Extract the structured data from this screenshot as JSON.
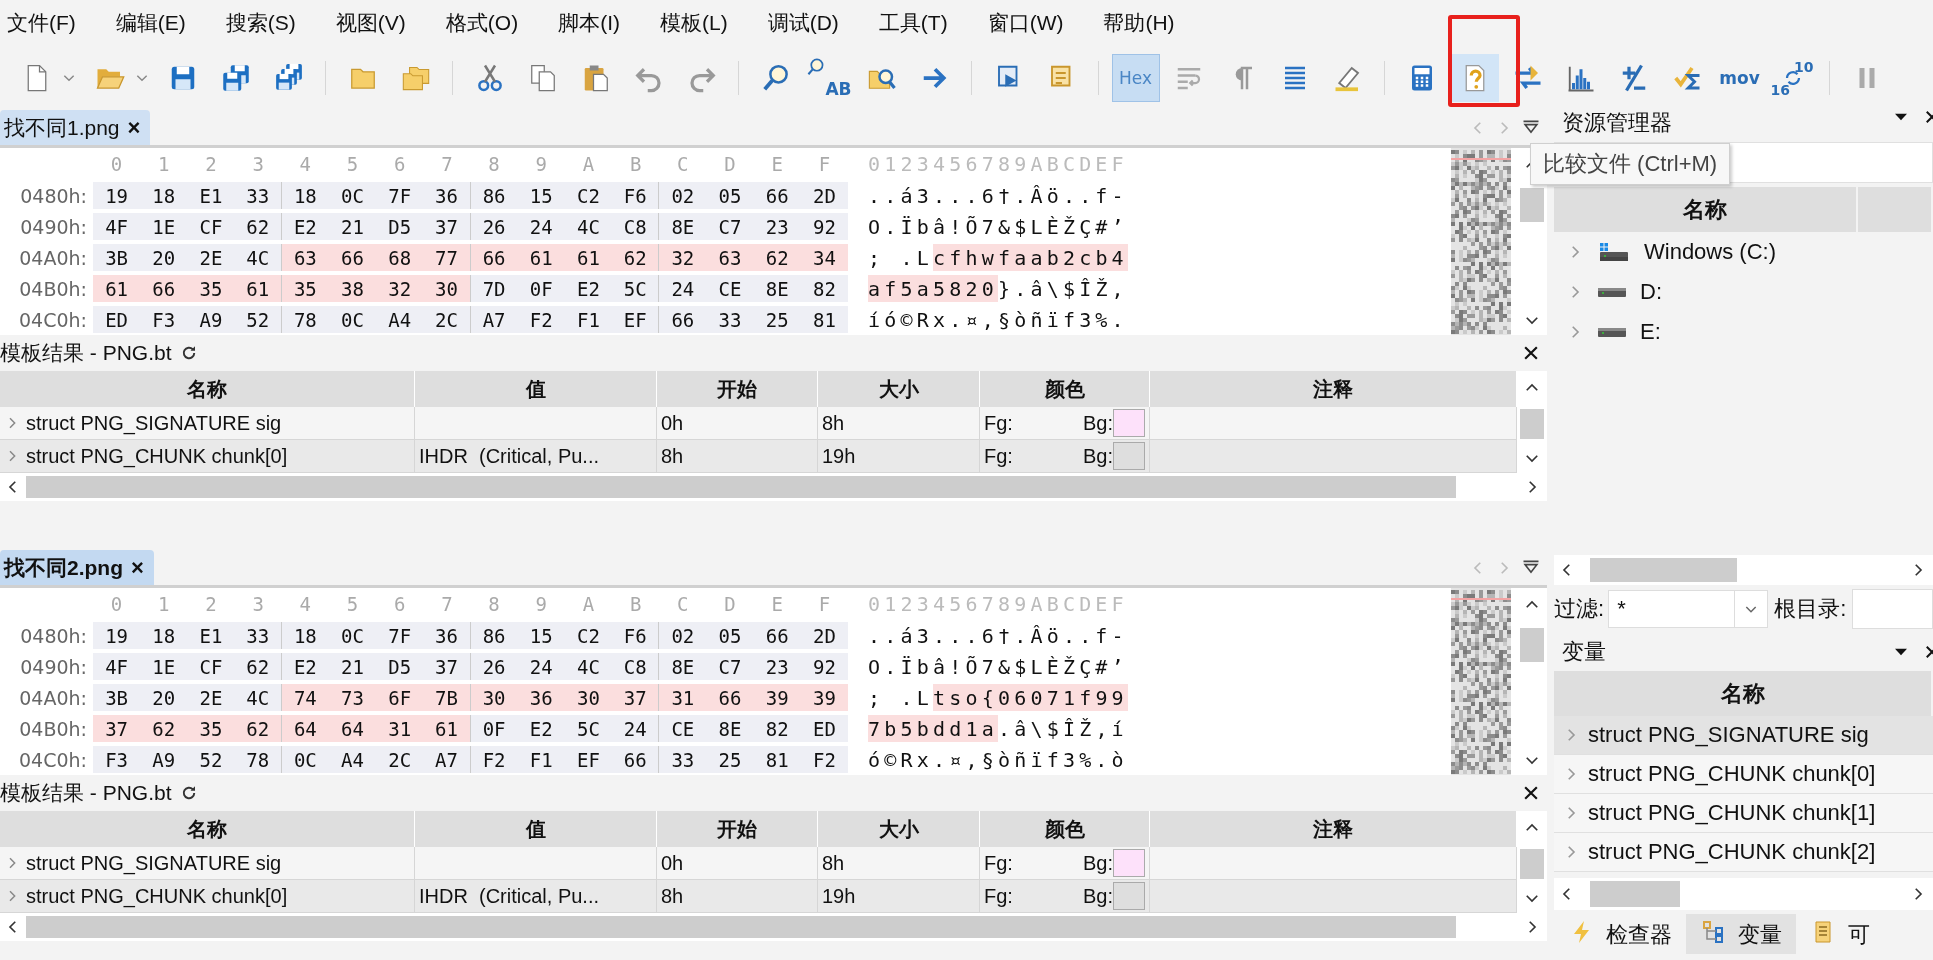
{
  "menu": [
    "文件(F)",
    "编辑(E)",
    "搜索(S)",
    "视图(V)",
    "格式(O)",
    "脚本(I)",
    "模板(L)",
    "调试(D)",
    "工具(T)",
    "窗口(W)",
    "帮助(H)"
  ],
  "toolbar": [
    {
      "kind": "icon"
    },
    {
      "kind": "dropdown"
    },
    {
      "kind": "icon"
    },
    {
      "kind": "dropdown"
    },
    {
      "kind": "icon"
    },
    {
      "kind": "icon"
    },
    {
      "kind": "icon"
    },
    {
      "kind": "separator"
    },
    {
      "kind": "icon"
    },
    {
      "kind": "icon"
    },
    {
      "kind": "separator"
    },
    {
      "kind": "icon"
    },
    {
      "kind": "icon"
    },
    {
      "kind": "icon"
    },
    {
      "kind": "icon"
    },
    {
      "kind": "icon"
    },
    {
      "kind": "separator"
    },
    {
      "kind": "icon"
    },
    {
      "kind": "icon",
      "label": "AB"
    },
    {
      "kind": "icon"
    },
    {
      "kind": "icon"
    },
    {
      "kind": "separator"
    },
    {
      "kind": "icon"
    },
    {
      "kind": "icon"
    },
    {
      "kind": "separator"
    },
    {
      "kind": "toggle",
      "label": "Hex",
      "on": true
    },
    {
      "kind": "icon"
    },
    {
      "kind": "icon"
    },
    {
      "kind": "icon"
    },
    {
      "kind": "icon"
    },
    {
      "kind": "separator"
    },
    {
      "kind": "icon"
    },
    {
      "kind": "icon",
      "hovered": true,
      "annotated": true
    },
    {
      "kind": "icon"
    },
    {
      "kind": "icon"
    },
    {
      "kind": "icon"
    },
    {
      "kind": "icon"
    },
    {
      "kind": "text",
      "label": "mov"
    },
    {
      "kind": "convert",
      "labels": [
        "10",
        "16"
      ]
    },
    {
      "kind": "separator"
    },
    {
      "kind": "icon"
    }
  ],
  "tooltip": {
    "text": "比较文件 (Ctrl+M)"
  },
  "files": [
    {
      "tab": {
        "label": "找不同1.png",
        "close": "×",
        "selected": false
      },
      "hex": {
        "columns": [
          "0",
          "1",
          "2",
          "3",
          "4",
          "5",
          "6",
          "7",
          "8",
          "9",
          "A",
          "B",
          "C",
          "D",
          "E",
          "F"
        ],
        "ascii_header": "0123456789ABCDEF",
        "rows": [
          {
            "address": "0480h:",
            "bytes": [
              {
                "text": "19",
                "diff": false
              },
              {
                "text": "18",
                "diff": false
              },
              {
                "text": "E1",
                "diff": false
              },
              {
                "text": "33",
                "diff": false
              },
              {
                "text": "18",
                "diff": false
              },
              {
                "text": "0C",
                "diff": false
              },
              {
                "text": "7F",
                "diff": false
              },
              {
                "text": "36",
                "diff": false
              },
              {
                "text": "86",
                "diff": false
              },
              {
                "text": "15",
                "diff": false
              },
              {
                "text": "C2",
                "diff": false
              },
              {
                "text": "F6",
                "diff": false
              },
              {
                "text": "02",
                "diff": false
              },
              {
                "text": "05",
                "diff": false
              },
              {
                "text": "66",
                "diff": false
              },
              {
                "text": "2D",
                "diff": false
              }
            ],
            "ascii": [
              {
                "text": "..á3...6†.Âö..f-",
                "diff": false
              }
            ]
          },
          {
            "address": "0490h:",
            "bytes": [
              {
                "text": "4F",
                "diff": false
              },
              {
                "text": "1E",
                "diff": false
              },
              {
                "text": "CF",
                "diff": false
              },
              {
                "text": "62",
                "diff": false
              },
              {
                "text": "E2",
                "diff": false
              },
              {
                "text": "21",
                "diff": false
              },
              {
                "text": "D5",
                "diff": false
              },
              {
                "text": "37",
                "diff": false
              },
              {
                "text": "26",
                "diff": false
              },
              {
                "text": "24",
                "diff": false
              },
              {
                "text": "4C",
                "diff": false
              },
              {
                "text": "C8",
                "diff": false
              },
              {
                "text": "8E",
                "diff": false
              },
              {
                "text": "C7",
                "diff": false
              },
              {
                "text": "23",
                "diff": false
              },
              {
                "text": "92",
                "diff": false
              }
            ],
            "ascii": [
              {
                "text": "O.Ïbâ!Õ7&$LÈŽÇ#’",
                "diff": false
              }
            ]
          },
          {
            "address": "04A0h:",
            "bytes": [
              {
                "text": "3B",
                "diff": false
              },
              {
                "text": "20",
                "diff": false
              },
              {
                "text": "2E",
                "diff": false
              },
              {
                "text": "4C",
                "diff": false
              },
              {
                "text": "63",
                "diff": true
              },
              {
                "text": "66",
                "diff": true
              },
              {
                "text": "68",
                "diff": true
              },
              {
                "text": "77",
                "diff": true
              },
              {
                "text": "66",
                "diff": true
              },
              {
                "text": "61",
                "diff": true
              },
              {
                "text": "61",
                "diff": true
              },
              {
                "text": "62",
                "diff": true
              },
              {
                "text": "32",
                "diff": true
              },
              {
                "text": "63",
                "diff": true
              },
              {
                "text": "62",
                "diff": true
              },
              {
                "text": "34",
                "diff": true
              }
            ],
            "ascii": [
              {
                "text": "; .L",
                "diff": false
              },
              {
                "text": "cfhwfaab2cb4",
                "diff": true
              }
            ]
          },
          {
            "address": "04B0h:",
            "bytes": [
              {
                "text": "61",
                "diff": true
              },
              {
                "text": "66",
                "diff": true
              },
              {
                "text": "35",
                "diff": true
              },
              {
                "text": "61",
                "diff": true
              },
              {
                "text": "35",
                "diff": true
              },
              {
                "text": "38",
                "diff": true
              },
              {
                "text": "32",
                "diff": true
              },
              {
                "text": "30",
                "diff": true
              },
              {
                "text": "7D",
                "diff": false
              },
              {
                "text": "0F",
                "diff": false
              },
              {
                "text": "E2",
                "diff": false
              },
              {
                "text": "5C",
                "diff": false
              },
              {
                "text": "24",
                "diff": false
              },
              {
                "text": "CE",
                "diff": false
              },
              {
                "text": "8E",
                "diff": false
              },
              {
                "text": "82",
                "diff": false
              }
            ],
            "ascii": [
              {
                "text": "af5a5820",
                "diff": true
              },
              {
                "text": "}.â\\$ÎŽ,",
                "diff": false
              }
            ]
          },
          {
            "address": "04C0h:",
            "bytes": [
              {
                "text": "ED",
                "diff": false
              },
              {
                "text": "F3",
                "diff": false
              },
              {
                "text": "A9",
                "diff": false
              },
              {
                "text": "52",
                "diff": false
              },
              {
                "text": "78",
                "diff": false
              },
              {
                "text": "0C",
                "diff": false
              },
              {
                "text": "A4",
                "diff": false
              },
              {
                "text": "2C",
                "diff": false
              },
              {
                "text": "A7",
                "diff": false
              },
              {
                "text": "F2",
                "diff": false
              },
              {
                "text": "F1",
                "diff": false
              },
              {
                "text": "EF",
                "diff": false
              },
              {
                "text": "66",
                "diff": false
              },
              {
                "text": "33",
                "diff": false
              },
              {
                "text": "25",
                "diff": false
              },
              {
                "text": "81",
                "diff": false
              }
            ],
            "ascii": [
              {
                "text": "íó©Rx.¤,§òñïf3%.",
                "diff": false
              }
            ]
          }
        ]
      },
      "template": {
        "title": "模板结果 - PNG.bt",
        "columns": [
          "名称",
          "值",
          "开始",
          "大小",
          "颜色",
          "注释"
        ],
        "rows": [
          {
            "name": "struct PNG_SIGNATURE sig",
            "start": "0h",
            "size": "8h",
            "fg": "Fg:",
            "bg": "Bg:",
            "color": "#fde1fa"
          },
          {
            "name": "struct PNG_CHUNK chunk[0]",
            "value": "IHDR  (Critical, Pu...",
            "start": "8h",
            "size": "19h",
            "fg": "Fg:",
            "bg": "Bg:",
            "color": "#dedede"
          }
        ]
      }
    },
    {
      "tab": {
        "label": "找不同2.png",
        "close": "×",
        "selected": true
      },
      "hex": {
        "columns": [
          "0",
          "1",
          "2",
          "3",
          "4",
          "5",
          "6",
          "7",
          "8",
          "9",
          "A",
          "B",
          "C",
          "D",
          "E",
          "F"
        ],
        "ascii_header": "0123456789ABCDEF",
        "rows": [
          {
            "address": "0480h:",
            "bytes": [
              {
                "text": "19",
                "diff": false
              },
              {
                "text": "18",
                "diff": false
              },
              {
                "text": "E1",
                "diff": false
              },
              {
                "text": "33",
                "diff": false
              },
              {
                "text": "18",
                "diff": false
              },
              {
                "text": "0C",
                "diff": false
              },
              {
                "text": "7F",
                "diff": false
              },
              {
                "text": "36",
                "diff": false
              },
              {
                "text": "86",
                "diff": false
              },
              {
                "text": "15",
                "diff": false
              },
              {
                "text": "C2",
                "diff": false
              },
              {
                "text": "F6",
                "diff": false
              },
              {
                "text": "02",
                "diff": false
              },
              {
                "text": "05",
                "diff": false
              },
              {
                "text": "66",
                "diff": false
              },
              {
                "text": "2D",
                "diff": false
              }
            ],
            "ascii": [
              {
                "text": "..á3...6†.Âö..f-",
                "diff": false
              }
            ]
          },
          {
            "address": "0490h:",
            "bytes": [
              {
                "text": "4F",
                "diff": false
              },
              {
                "text": "1E",
                "diff": false
              },
              {
                "text": "CF",
                "diff": false
              },
              {
                "text": "62",
                "diff": false
              },
              {
                "text": "E2",
                "diff": false
              },
              {
                "text": "21",
                "diff": false
              },
              {
                "text": "D5",
                "diff": false
              },
              {
                "text": "37",
                "diff": false
              },
              {
                "text": "26",
                "diff": false
              },
              {
                "text": "24",
                "diff": false
              },
              {
                "text": "4C",
                "diff": false
              },
              {
                "text": "C8",
                "diff": false
              },
              {
                "text": "8E",
                "diff": false
              },
              {
                "text": "C7",
                "diff": false
              },
              {
                "text": "23",
                "diff": false
              },
              {
                "text": "92",
                "diff": false
              }
            ],
            "ascii": [
              {
                "text": "O.Ïbâ!Õ7&$LÈŽÇ#’",
                "diff": false
              }
            ]
          },
          {
            "address": "04A0h:",
            "bytes": [
              {
                "text": "3B",
                "diff": false
              },
              {
                "text": "20",
                "diff": false
              },
              {
                "text": "2E",
                "diff": false
              },
              {
                "text": "4C",
                "diff": false
              },
              {
                "text": "74",
                "diff": true
              },
              {
                "text": "73",
                "diff": true
              },
              {
                "text": "6F",
                "diff": true
              },
              {
                "text": "7B",
                "diff": true
              },
              {
                "text": "30",
                "diff": true
              },
              {
                "text": "36",
                "diff": true
              },
              {
                "text": "30",
                "diff": true
              },
              {
                "text": "37",
                "diff": true
              },
              {
                "text": "31",
                "diff": true
              },
              {
                "text": "66",
                "diff": true
              },
              {
                "text": "39",
                "diff": true
              },
              {
                "text": "39",
                "diff": true
              }
            ],
            "ascii": [
              {
                "text": "; .L",
                "diff": false
              },
              {
                "text": "tso{06071f99",
                "diff": true
              }
            ]
          },
          {
            "address": "04B0h:",
            "bytes": [
              {
                "text": "37",
                "diff": true
              },
              {
                "text": "62",
                "diff": true
              },
              {
                "text": "35",
                "diff": true
              },
              {
                "text": "62",
                "diff": true
              },
              {
                "text": "64",
                "diff": true
              },
              {
                "text": "64",
                "diff": true
              },
              {
                "text": "31",
                "diff": true
              },
              {
                "text": "61",
                "diff": true
              },
              {
                "text": "0F",
                "diff": false
              },
              {
                "text": "E2",
                "diff": false
              },
              {
                "text": "5C",
                "diff": false
              },
              {
                "text": "24",
                "diff": false
              },
              {
                "text": "CE",
                "diff": false
              },
              {
                "text": "8E",
                "diff": false
              },
              {
                "text": "82",
                "diff": false
              },
              {
                "text": "ED",
                "diff": false
              }
            ],
            "ascii": [
              {
                "text": "7b5bdd1a",
                "diff": true
              },
              {
                "text": ".â\\$ÎŽ,í",
                "diff": false
              }
            ]
          },
          {
            "address": "04C0h:",
            "bytes": [
              {
                "text": "F3",
                "diff": false
              },
              {
                "text": "A9",
                "diff": false
              },
              {
                "text": "52",
                "diff": false
              },
              {
                "text": "78",
                "diff": false
              },
              {
                "text": "0C",
                "diff": false
              },
              {
                "text": "A4",
                "diff": false
              },
              {
                "text": "2C",
                "diff": false
              },
              {
                "text": "A7",
                "diff": false
              },
              {
                "text": "F2",
                "diff": false
              },
              {
                "text": "F1",
                "diff": false
              },
              {
                "text": "EF",
                "diff": false
              },
              {
                "text": "66",
                "diff": false
              },
              {
                "text": "33",
                "diff": false
              },
              {
                "text": "25",
                "diff": false
              },
              {
                "text": "81",
                "diff": false
              },
              {
                "text": "F2",
                "diff": false
              }
            ],
            "ascii": [
              {
                "text": "ó©Rx.¤,§òñïf3%.ò",
                "diff": false
              }
            ]
          }
        ]
      },
      "template": {
        "title": "模板结果 - PNG.bt",
        "columns": [
          "名称",
          "值",
          "开始",
          "大小",
          "颜色",
          "注释"
        ],
        "rows": [
          {
            "name": "struct PNG_SIGNATURE sig",
            "start": "0h",
            "size": "8h",
            "fg": "Fg:",
            "bg": "Bg:",
            "color": "#fde1fa"
          },
          {
            "name": "struct PNG_CHUNK chunk[0]",
            "value": "IHDR  (Critical, Pu...",
            "start": "8h",
            "size": "19h",
            "fg": "Fg:",
            "bg": "Bg:",
            "color": "#dedede"
          }
        ]
      }
    }
  ],
  "explorer": {
    "title": "资源管理器",
    "column": "名称",
    "items": [
      {
        "label": "Windows (C:)",
        "kind": "system"
      },
      {
        "label": "D:",
        "kind": "drive"
      },
      {
        "label": "E:",
        "kind": "drive"
      }
    ]
  },
  "filter": {
    "label": "过滤:",
    "value": "*",
    "root_label": "根目录:"
  },
  "variables": {
    "title": "变量",
    "column": "名称",
    "rows": [
      {
        "label": "struct PNG_SIGNATURE sig",
        "selected": true
      },
      {
        "label": "struct PNG_CHUNK chunk[0]",
        "selected": false
      },
      {
        "label": "struct PNG_CHUNK chunk[1]",
        "selected": false
      },
      {
        "label": "struct PNG_CHUNK chunk[2]",
        "selected": false
      }
    ]
  },
  "bottom_tabs": [
    {
      "label": "检查器",
      "selected": false
    },
    {
      "label": "变量",
      "selected": true
    },
    {
      "label": "可",
      "selected": false
    }
  ]
}
